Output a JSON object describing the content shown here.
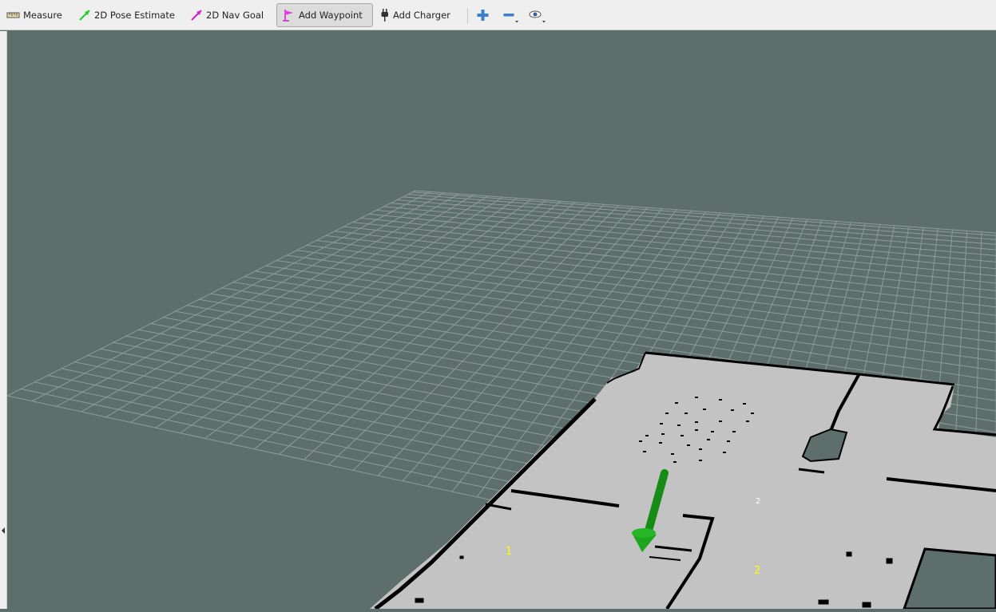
{
  "toolbar": {
    "measure_label": "Measure",
    "pose_label": "2D Pose Estimate",
    "nav_goal_label": "2D Nav Goal",
    "waypoint_label": "Add Waypoint",
    "charger_label": "Add Charger",
    "active_tool": "Add Waypoint",
    "icons": [
      "ruler-icon",
      "green-arrow-icon",
      "magenta-arrow-icon",
      "waypoint-flag-icon",
      "plug-icon",
      "zoom-in-icon",
      "zoom-out-icon",
      "eye-icon"
    ]
  },
  "viewport": {
    "background_color": "#5e6e6a",
    "map_color": "#c3c3c3",
    "wall_color": "#000000",
    "arrow_color": "#1e9a1e",
    "labels": [
      {
        "text": "1",
        "color": "#ffff00"
      },
      {
        "text": "2",
        "color": "#ffffff"
      },
      {
        "text": "2",
        "color": "#ffff00"
      }
    ]
  }
}
